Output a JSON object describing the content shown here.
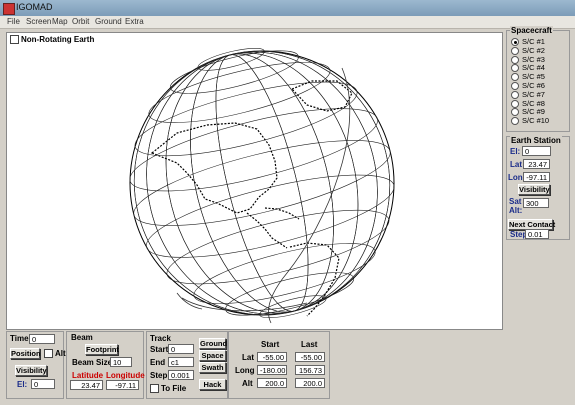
{
  "window": {
    "title": "IGOMAD"
  },
  "menu": [
    "File",
    "Screen",
    "Map",
    "Orbit",
    "Ground",
    "Extra"
  ],
  "canvas": {
    "non_rotating_label": "Non-Rotating Earth"
  },
  "spacecraft": {
    "title": "Spacecraft",
    "items": [
      "S/C #1",
      "S/C #2",
      "S/C #3",
      "S/C #4",
      "S/C #5",
      "S/C #6",
      "S/C #7",
      "S/C #8",
      "S/C #9",
      "S/C #10"
    ],
    "selected": "S/C #1"
  },
  "earth_station": {
    "title": "Earth Station",
    "el_label": "El:",
    "el_value": "0",
    "lat_label": "Lat",
    "lat_value": "23.47",
    "long_label": "Long",
    "long_value": "-97.11",
    "visibility_label": "Visibility",
    "sat_alt_label_1": "Sat",
    "sat_alt_label_2": "Alt:",
    "sat_alt_value": "300",
    "next_contact_label": "Next Contact",
    "step_label": "Step",
    "step_value": "0.01"
  },
  "time": {
    "label": "Time",
    "value": "0",
    "position_label": "Position",
    "alt_label": "Alt"
  },
  "visibility_box": {
    "button_label": "Visibility",
    "el_label": "El:",
    "el_value": "0"
  },
  "beam": {
    "title": "Beam",
    "footprint_label": "Footprint",
    "size_label": "Beam Size",
    "size_value": "10",
    "lat_label": "Latitude",
    "lon_label": "Longitude",
    "lat_value": "23.47",
    "lon_value": "-97.11"
  },
  "track": {
    "title": "Track",
    "start_label": "Start",
    "start_value": "0",
    "end_label": "End",
    "end_value": "c1",
    "step_label": "Step",
    "step_value": "0.001",
    "to_file_label": "To File",
    "ground_label": "Ground",
    "space_label": "Space",
    "swath_label": "Swath",
    "hack_label": "Hack",
    "col_start": "Start",
    "col_last": "Last",
    "lat_label": "Lat",
    "long_label": "Long",
    "alt_label": "Alt",
    "lat_start": "-55.00",
    "lat_last": "-55.00",
    "long_start": "-180.00",
    "long_last": "156.73",
    "alt_start": "200.0",
    "alt_last": "200.0"
  },
  "colors": {
    "panel_bg": "#d4d0c8",
    "label_blue": "#1a2c8a",
    "label_red": "#c00000"
  }
}
